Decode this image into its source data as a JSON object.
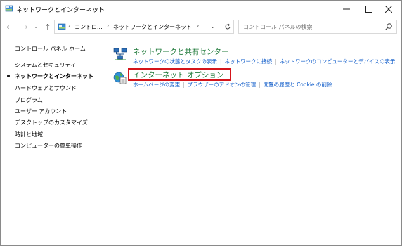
{
  "window": {
    "title": "ネットワークとインターネット",
    "controls": {
      "minimize": "—",
      "maximize": "☐",
      "close": "✕"
    }
  },
  "nav": {
    "back": "←",
    "forward": "→",
    "dropdown": "⌄",
    "up": "↑"
  },
  "address": {
    "breadcrumbs": [
      "コントロ...",
      "ネットワークとインターネット"
    ],
    "separator": "›",
    "dropdown": "⌄"
  },
  "search": {
    "placeholder": "コントロール パネルの検索"
  },
  "sidebar": {
    "items": [
      {
        "label": "コントロール パネル ホーム",
        "active": false
      },
      {
        "label": "システムとセキュリティ",
        "active": false
      },
      {
        "label": "ネットワークとインターネット",
        "active": true
      },
      {
        "label": "ハードウェアとサウンド",
        "active": false
      },
      {
        "label": "プログラム",
        "active": false
      },
      {
        "label": "ユーザー アカウント",
        "active": false
      },
      {
        "label": "デスクトップのカスタマイズ",
        "active": false
      },
      {
        "label": "時計と地域",
        "active": false
      },
      {
        "label": "コンピューターの簡単操作",
        "active": false
      }
    ]
  },
  "categories": [
    {
      "title": "ネットワークと共有センター",
      "links": [
        "ネットワークの状態とタスクの表示",
        "ネットワークに接続",
        "ネットワークのコンピューターとデバイスの表示"
      ],
      "icon": "network-sharing-icon"
    },
    {
      "title": "インターネット オプション",
      "links": [
        "ホームページの変更",
        "ブラウザーのアドオンの管理",
        "閲覧の履歴と Cookie の削除"
      ],
      "icon": "internet-options-icon"
    }
  ],
  "colors": {
    "category_title": "#1f7a3a",
    "link": "#0a58c8",
    "highlight": "#d4151b"
  }
}
